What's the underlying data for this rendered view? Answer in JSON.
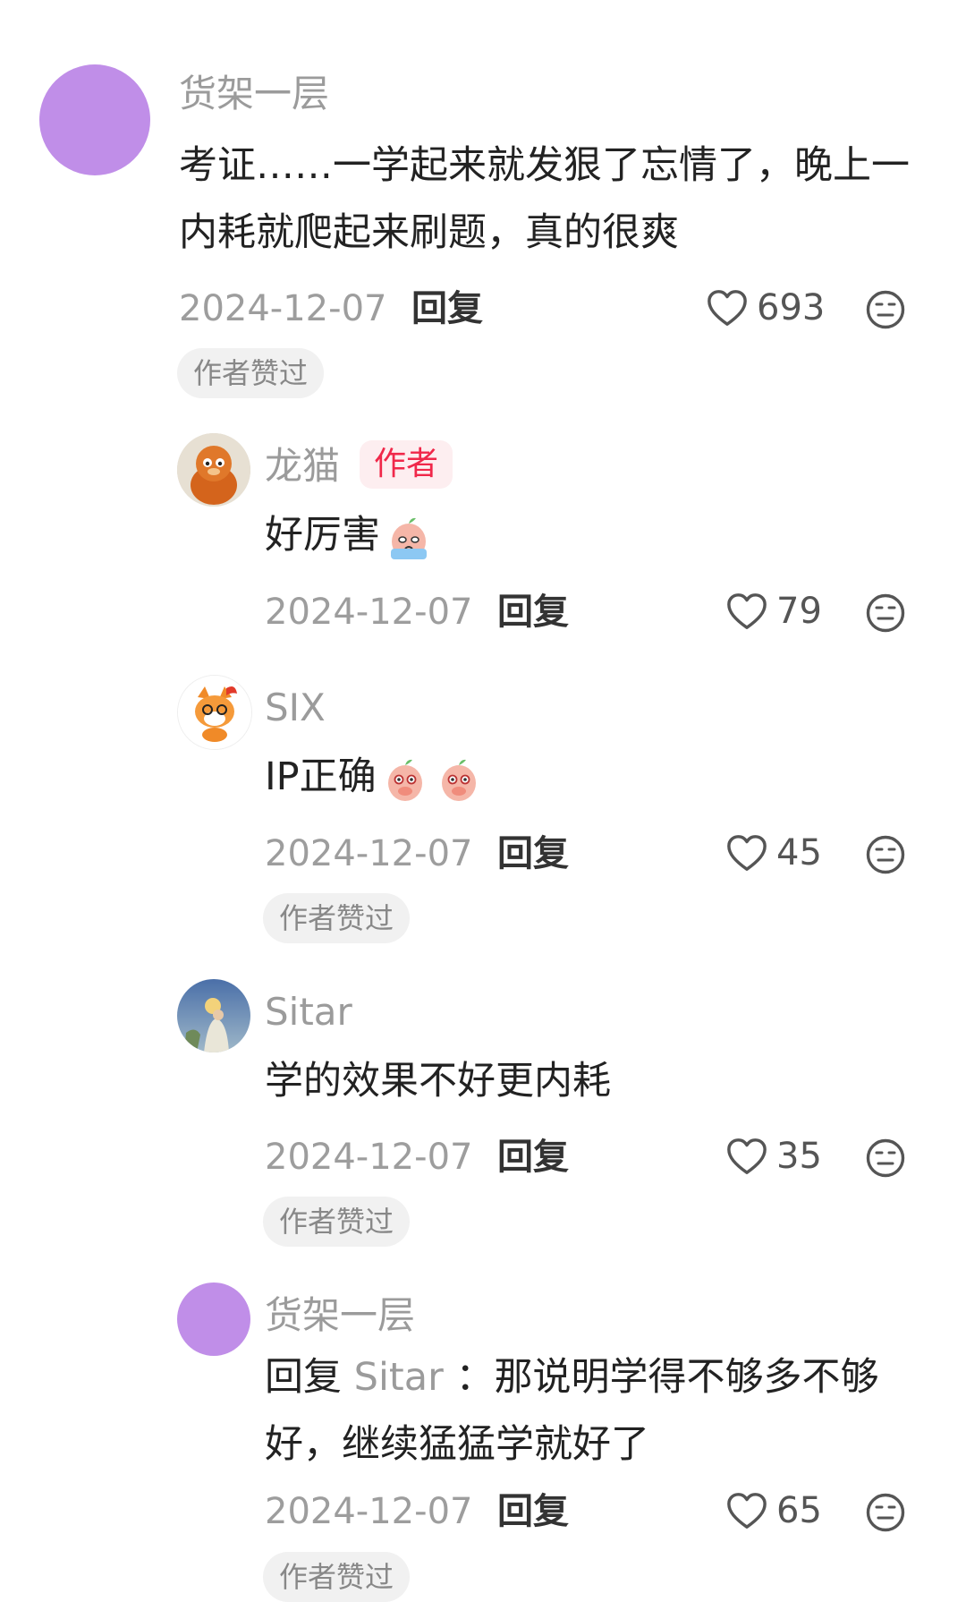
{
  "colors": {
    "avatar_purple": "#c08ee8",
    "author_tag_bg": "#fdeef0",
    "author_tag_text": "#f0284a",
    "badge_bg": "#f1f1f1"
  },
  "comments": [
    {
      "username": "货架一层",
      "text": "考证……一学起来就发狠了忘情了，晚上一内耗就爬起来刷题，真的很爽",
      "date": "2024-12-07",
      "reply_label": "回复",
      "likes": "693",
      "badge": "作者赞过",
      "avatar": "purple-circle"
    },
    {
      "username": "龙猫",
      "author_tag": "作者",
      "text": "好厉害",
      "emoji": "crying-peach-emoji",
      "date": "2024-12-07",
      "reply_label": "回复",
      "likes": "79",
      "avatar": "orange-plush-toy"
    },
    {
      "username": "SIX",
      "text": "IP正确",
      "emoji": "covering-mouth-peach-emoji",
      "date": "2024-12-07",
      "reply_label": "回复",
      "likes": "45",
      "badge": "作者赞过",
      "avatar": "cartoon-fox"
    },
    {
      "username": "Sitar",
      "text": "学的效果不好更内耗",
      "date": "2024-12-07",
      "reply_label": "回复",
      "likes": "35",
      "badge": "作者赞过",
      "avatar": "painting-figure"
    },
    {
      "username": "货架一层",
      "reply_prefix": "回复",
      "reply_to": "Sitar",
      "reply_colon": "：",
      "text": "那说明学得不够多不够好，继续猛猛学就好了",
      "date": "2024-12-07",
      "reply_label": "回复",
      "likes": "65",
      "badge": "作者赞过",
      "avatar": "purple-circle"
    }
  ]
}
